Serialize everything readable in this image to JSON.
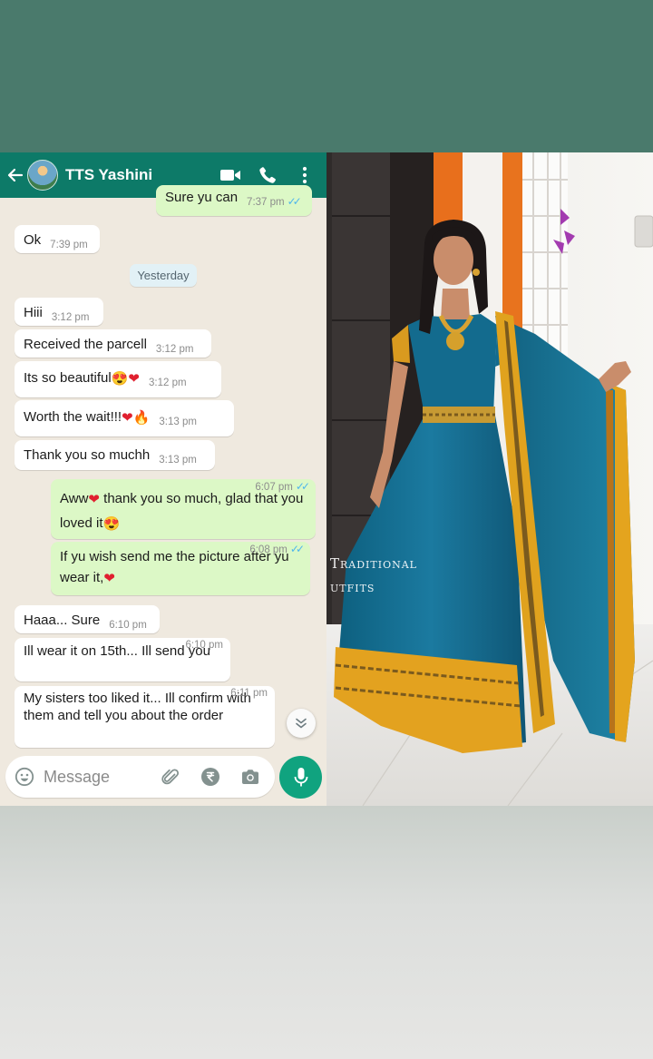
{
  "header": {
    "contact_name": "TTS Yashini"
  },
  "date_chip": "Yesterday",
  "messages": [
    {
      "direction": "out",
      "text": "Sure yu can",
      "time": "7:37 pm",
      "status": "read"
    },
    {
      "direction": "in",
      "text": "Ok",
      "time": "7:39 pm"
    },
    {
      "direction": "in",
      "text": "Hiii",
      "time": "3:12 pm"
    },
    {
      "direction": "in",
      "text": "Received the parcell",
      "time": "3:12 pm"
    },
    {
      "direction": "in",
      "text": "Its so beautiful",
      "time": "3:12 pm",
      "emojis": [
        "heart-eyes",
        "red-heart"
      ]
    },
    {
      "direction": "in",
      "text": "Worth the wait!!!",
      "time": "3:13 pm",
      "emojis": [
        "red-heart",
        "fire"
      ]
    },
    {
      "direction": "in",
      "text": "Thank you so muchh",
      "time": "3:13 pm"
    },
    {
      "direction": "out",
      "text_a": "Aww",
      "text_b": " thank you so much, glad that you loved it",
      "time": "6:07 pm",
      "status": "read",
      "emojis": [
        "red-heart",
        "heart-eyes"
      ]
    },
    {
      "direction": "out",
      "text": "If yu wish send me the picture after yu wear it,",
      "time": "6:08 pm",
      "status": "read",
      "emojis": [
        "red-heart"
      ]
    },
    {
      "direction": "in",
      "text": "Haaa... Sure",
      "time": "6:10 pm"
    },
    {
      "direction": "in",
      "text": "Ill wear it on 15th... Ill send you",
      "time": "6:10 pm"
    },
    {
      "direction": "in",
      "text": "My sisters too liked it... Ill confirm with them and tell you about the order",
      "time": "6:11 pm"
    }
  ],
  "composer": {
    "placeholder": "Message"
  },
  "photo": {
    "watermark_line1": "Traditional",
    "watermark_line2": "utfits"
  },
  "colors": {
    "header": "#0d7a68",
    "incoming_bubble": "#ffffff",
    "outgoing_bubble": "#dcf8c6",
    "chat_background": "#efe9df",
    "mic_button": "#10a37f",
    "read_ticks": "#4fb6ec"
  },
  "icons": [
    "back-arrow-icon",
    "video-call-icon",
    "phone-icon",
    "more-options-icon",
    "emoji-icon",
    "attach-icon",
    "rupee-icon",
    "camera-icon",
    "mic-icon",
    "chevron-down-icon"
  ]
}
